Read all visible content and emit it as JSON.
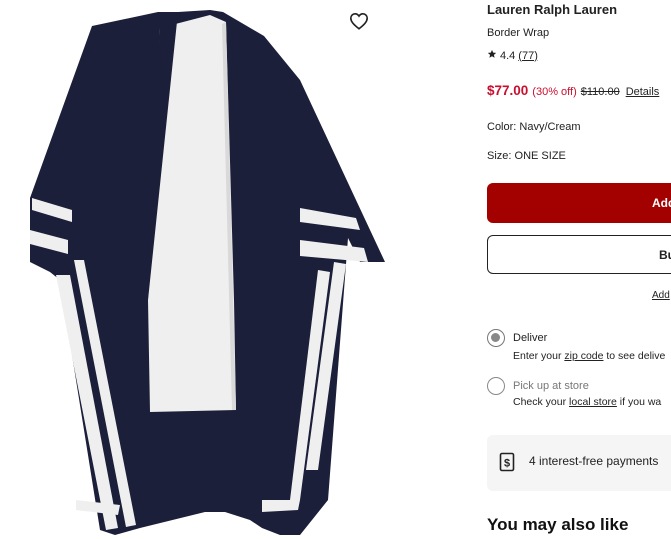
{
  "product": {
    "brand": "Lauren Ralph Lauren",
    "name": "Border Wrap",
    "rating": "4.4",
    "review_count": "(77)",
    "sale_price": "$77.00",
    "discount": "(30% off)",
    "original_price": "$110.00",
    "details_link": "Details",
    "color_label": "Color:",
    "color_value": "Navy/Cream",
    "size_label": "Size:",
    "size_value": "ONE SIZE"
  },
  "actions": {
    "add_label": "Add",
    "buy_label": "Bu",
    "add_link": "Add"
  },
  "fulfillment": {
    "deliver_title": "Deliver",
    "deliver_sub_prefix": "Enter your ",
    "deliver_sub_link": "zip code",
    "deliver_sub_suffix": " to see delive",
    "pickup_title": "Pick up at store",
    "pickup_sub_prefix": "Check your ",
    "pickup_sub_link": "local store",
    "pickup_sub_suffix": " if you wa",
    "selected": "deliver"
  },
  "payments": {
    "text": "4 interest-free payments"
  },
  "recommendations": {
    "heading": "You may also like"
  },
  "colors": {
    "sale_red": "#c8102e",
    "button_red": "#a30000",
    "navy": "#1c1f3a",
    "cream": "#efefef"
  },
  "icons": {
    "favorite": "heart-outline-icon",
    "star": "star-icon",
    "payments": "dollar-card-icon"
  }
}
